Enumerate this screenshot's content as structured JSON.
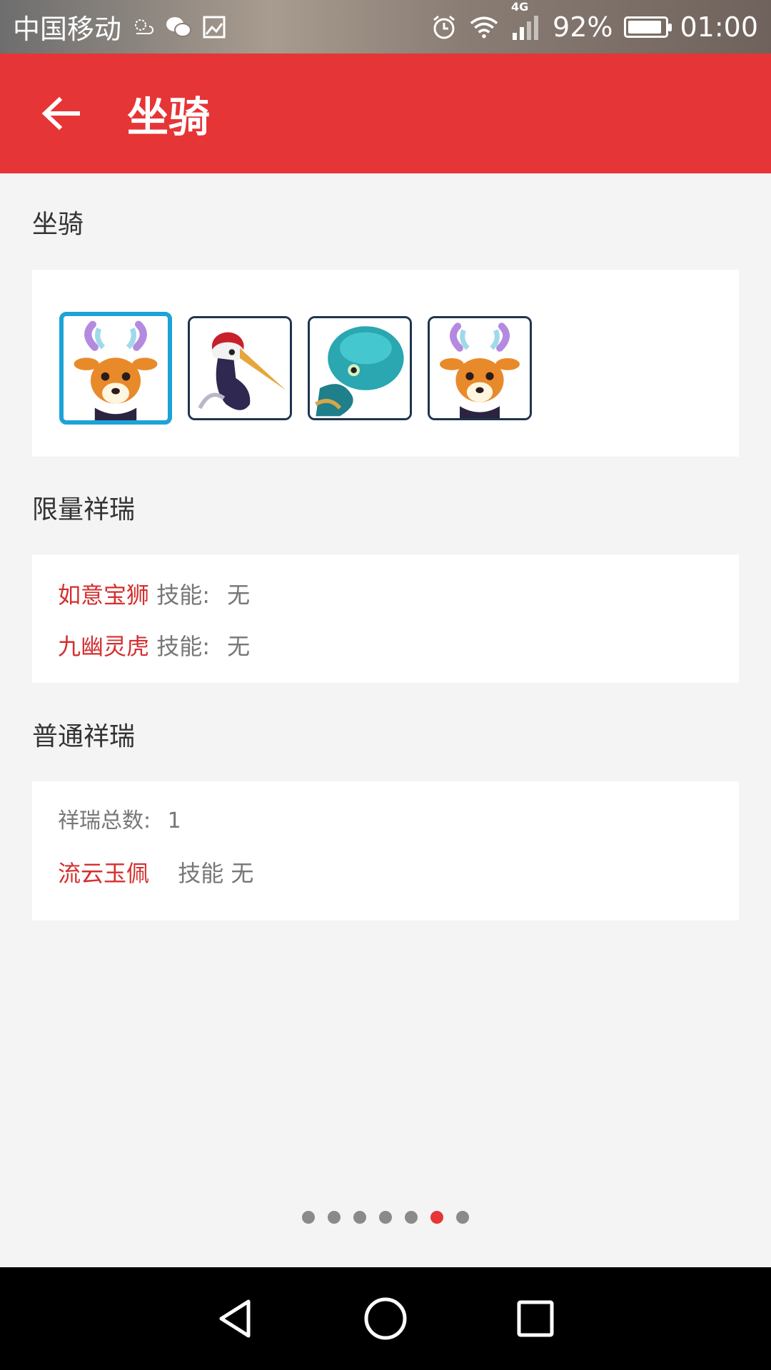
{
  "status_bar": {
    "carrier": "中国移动",
    "network": "4G",
    "battery": "92%",
    "battery_level": 0.92,
    "time": "01:00",
    "icons": [
      "weather-icon",
      "wechat-icon",
      "image-icon",
      "alarm-icon",
      "wifi-icon",
      "signal-icon",
      "battery-icon"
    ]
  },
  "app_bar": {
    "title": "坐骑",
    "back_icon": "arrow-left-icon"
  },
  "sections": {
    "mounts": {
      "title": "坐骑",
      "items": [
        "deer",
        "crane",
        "octopus",
        "deer"
      ],
      "selected_index": 0
    },
    "limited": {
      "title": "限量祥瑞",
      "items": [
        {
          "name": "如意宝狮",
          "skill_label": "技能:",
          "skill_value": "无"
        },
        {
          "name": "九幽灵虎",
          "skill_label": "技能:",
          "skill_value": "无"
        }
      ]
    },
    "normal": {
      "title": "普通祥瑞",
      "total_label": "祥瑞总数:",
      "total_value": "1",
      "items": [
        {
          "name": "流云玉佩",
          "skill_label": "技能",
          "skill_value": "无"
        }
      ]
    }
  },
  "pager": {
    "count": 7,
    "active_index": 5
  },
  "colors": {
    "accent": "#e63537",
    "highlight": "#d52f2f",
    "selected_border": "#1da3d6"
  }
}
